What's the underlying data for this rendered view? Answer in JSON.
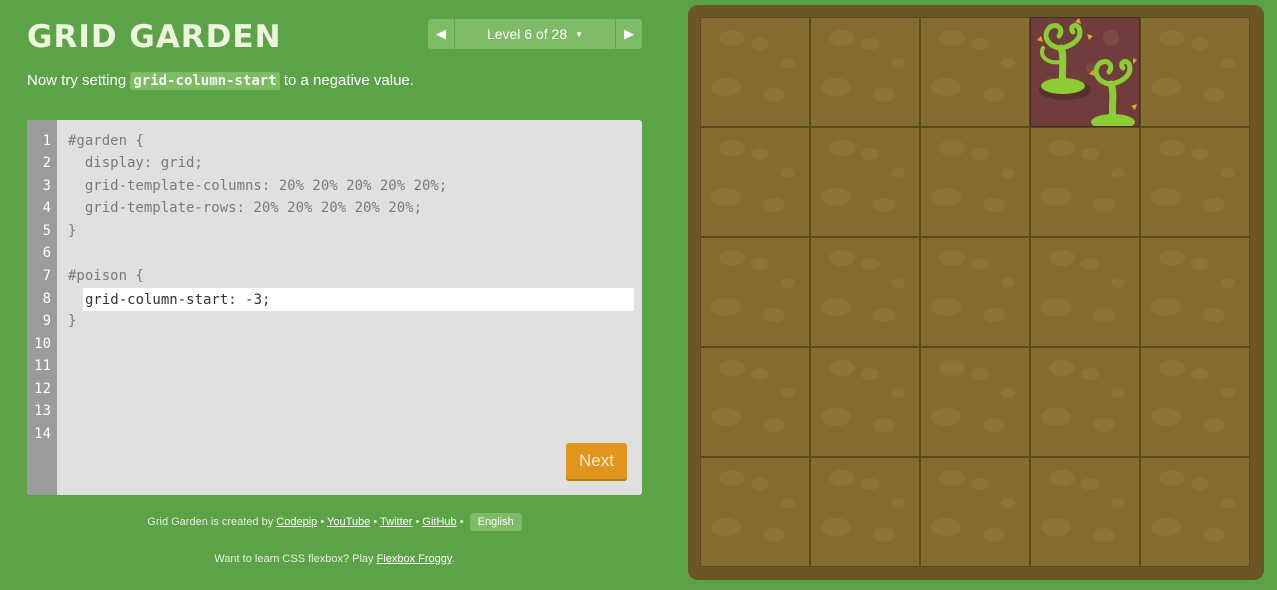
{
  "app": {
    "title": "GRID GARDEN"
  },
  "level_nav": {
    "label": "Level 6 of 28",
    "prev_icon": "triangle-left-icon",
    "next_icon": "triangle-right-icon",
    "dropdown_icon": "caret-down-icon"
  },
  "instructions": {
    "before": "Now try setting ",
    "code": "grid-column-start",
    "after": " to a negative value."
  },
  "editor": {
    "line_numbers": [
      "1",
      "2",
      "3",
      "4",
      "5",
      "6",
      "7",
      "8",
      "9",
      "10",
      "11",
      "12",
      "13",
      "14"
    ],
    "lines": [
      "#garden {",
      "  display: grid;",
      "  grid-template-columns: 20% 20% 20% 20% 20%;",
      "  grid-template-rows: 20% 20% 20% 20% 20%;",
      "}",
      "",
      "#poison {",
      "",
      "}"
    ],
    "input_value": "grid-column-start: -3;",
    "next_label": "Next"
  },
  "footer": {
    "created_prefix": "Grid Garden is created by ",
    "links": [
      "Codepip",
      "YouTube",
      "Twitter",
      "GitHub"
    ],
    "separator": " • ",
    "language": "English",
    "flexbox_prefix": "Want to learn CSS flexbox? Play ",
    "flexbox_link": "Flexbox Froggy",
    "flexbox_suffix": "."
  },
  "colors": {
    "background": "#5ba346",
    "soil": "#856d32",
    "poison": "#6f3d3c",
    "next_button": "#e0951d",
    "weed": "#8ccd33"
  }
}
